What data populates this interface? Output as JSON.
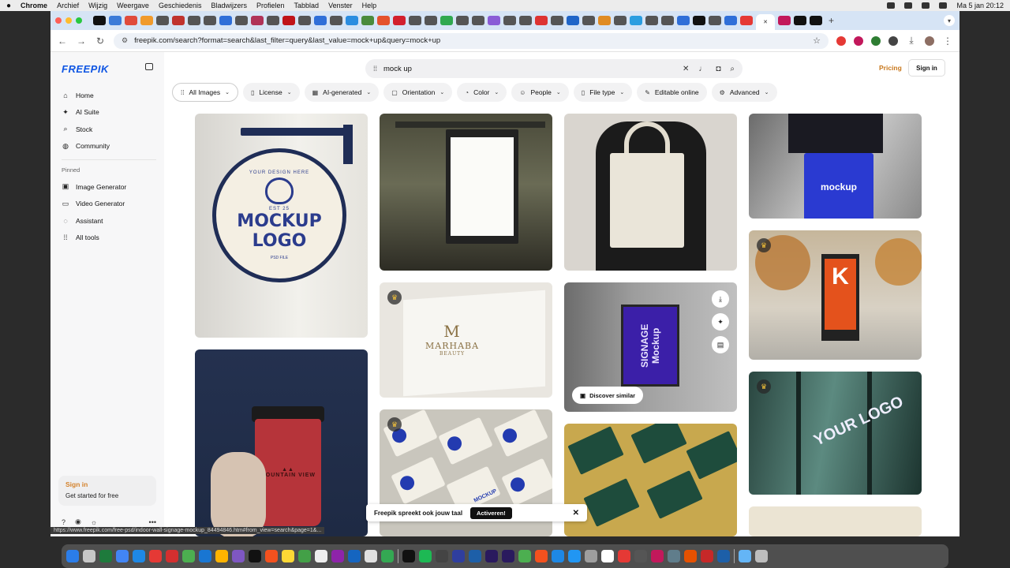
{
  "menubar": {
    "apple": "",
    "app": "Chrome",
    "items": [
      "Archief",
      "Wijzig",
      "Weergave",
      "Geschiedenis",
      "Bladwijzers",
      "Profielen",
      "Tabblad",
      "Venster",
      "Help"
    ],
    "clock": "Ma 5 jan  20:12"
  },
  "browser": {
    "url": "freepik.com/search?format=search&last_filter=query&last_value=mock+up&query=mock+up",
    "status_url": "https://www.freepik.com/free-psd/indoor-wall-signage-mockup_84494846.htm#from_view=search&page=1&..."
  },
  "sidebar": {
    "logo": "FREEPIK",
    "items": [
      {
        "icon": "home-icon",
        "label": "Home"
      },
      {
        "icon": "sparkle-icon",
        "label": "AI Suite"
      },
      {
        "icon": "search-icon",
        "label": "Stock"
      },
      {
        "icon": "globe-icon",
        "label": "Community"
      }
    ],
    "pinned_label": "Pinned",
    "pinned": [
      {
        "icon": "image-icon",
        "label": "Image Generator"
      },
      {
        "icon": "video-icon",
        "label": "Video Generator"
      },
      {
        "icon": "assistant-icon",
        "label": "Assistant"
      },
      {
        "icon": "grid-icon",
        "label": "All tools"
      }
    ],
    "signin_title": "Sign in",
    "signin_sub": "Get started for free"
  },
  "header": {
    "search_value": "mock up",
    "pricing": "Pricing",
    "signin": "Sign in"
  },
  "filters": [
    {
      "label": "All Images",
      "icon": "grid-icon"
    },
    {
      "label": "License",
      "icon": "doc-icon"
    },
    {
      "label": "AI-generated",
      "icon": "ai-icon"
    },
    {
      "label": "Orientation",
      "icon": "orientation-icon"
    },
    {
      "label": "Color",
      "icon": "palette-icon"
    },
    {
      "label": "People",
      "icon": "people-icon"
    },
    {
      "label": "File type",
      "icon": "file-icon"
    },
    {
      "label": "Editable online",
      "icon": "pencil-icon"
    },
    {
      "label": "Advanced",
      "icon": "gear-icon"
    }
  ],
  "tiles": {
    "sign": {
      "small": "YOUR DESIGN HERE",
      "line1": "MOCKUP",
      "line2": "LOGO",
      "est": "EST  25",
      "file": "PSD FILE"
    },
    "blue_bag": "mockup",
    "card": "MARHABA",
    "card_sub": "BEAUTY",
    "signage": "SIGNAGE Mockup",
    "k": "K",
    "cup": "MOUNTAIN VIEW",
    "cards2": "MOCKUP",
    "glass": "YOUR LOGO",
    "discover": "Discover similar"
  },
  "banner": {
    "text": "Freepik spreekt ook jouw taal",
    "action": "Activeren!"
  }
}
